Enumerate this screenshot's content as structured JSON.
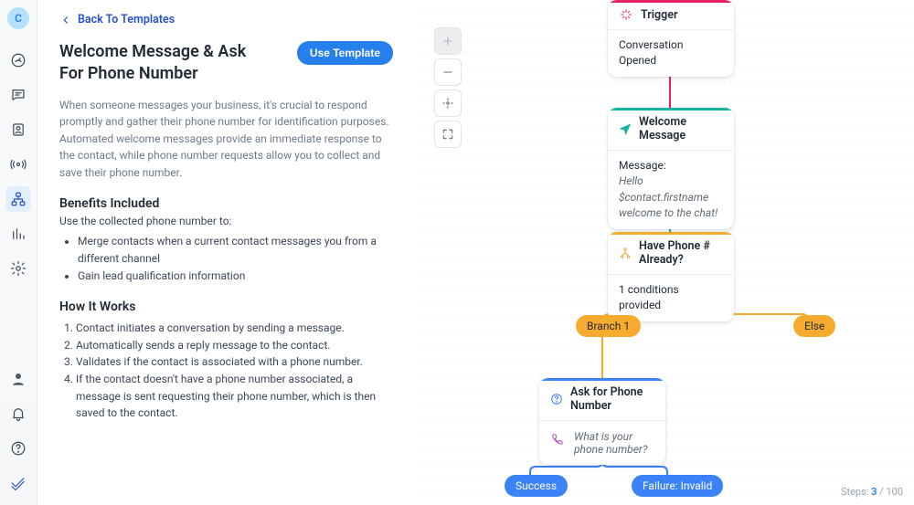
{
  "rail": {
    "avatar_letter": "C"
  },
  "header": {
    "back_label": "Back To Templates",
    "title": "Welcome Message & Ask For Phone Number",
    "use_button": "Use Template"
  },
  "description": "When someone messages your business, it's crucial to respond promptly and gather their phone number for identification purposes. Automated welcome messages provide an immediate response to the contact, while phone number requests allow you to collect and save their phone number.",
  "benefits_heading": "Benefits Included",
  "benefits_lead": "Use the collected phone number to:",
  "benefits": {
    "0": "Merge contacts when a current contact messages you from a different channel",
    "1": "Gain lead qualification information"
  },
  "how_heading": "How It Works",
  "steps": {
    "0": "Contact initiates a conversation by sending a message.",
    "1": "Automatically sends a reply message to the contact.",
    "2": "Validates if the contact is associated with a phone number.",
    "3": "If the contact doesn't have a phone number associated, a message is sent requesting their phone number, which is then saved to the contact."
  },
  "canvas": {
    "trigger": {
      "title": "Trigger",
      "body": "Conversation Opened"
    },
    "welcome": {
      "title": "Welcome Message",
      "msg_label": "Message:",
      "msg_body": "Hello $contact.firstname welcome to the chat!"
    },
    "condition": {
      "title": "Have Phone # Already?",
      "body": "1 conditions provided"
    },
    "branch1": "Branch 1",
    "else": "Else",
    "ask": {
      "title": "Ask for Phone Number",
      "body": "What is your phone number?"
    },
    "success": "Success",
    "failure": "Failure: Invalid",
    "steps_label": "Steps:",
    "steps_count": "3",
    "steps_sep": " / ",
    "steps_total": "100"
  }
}
